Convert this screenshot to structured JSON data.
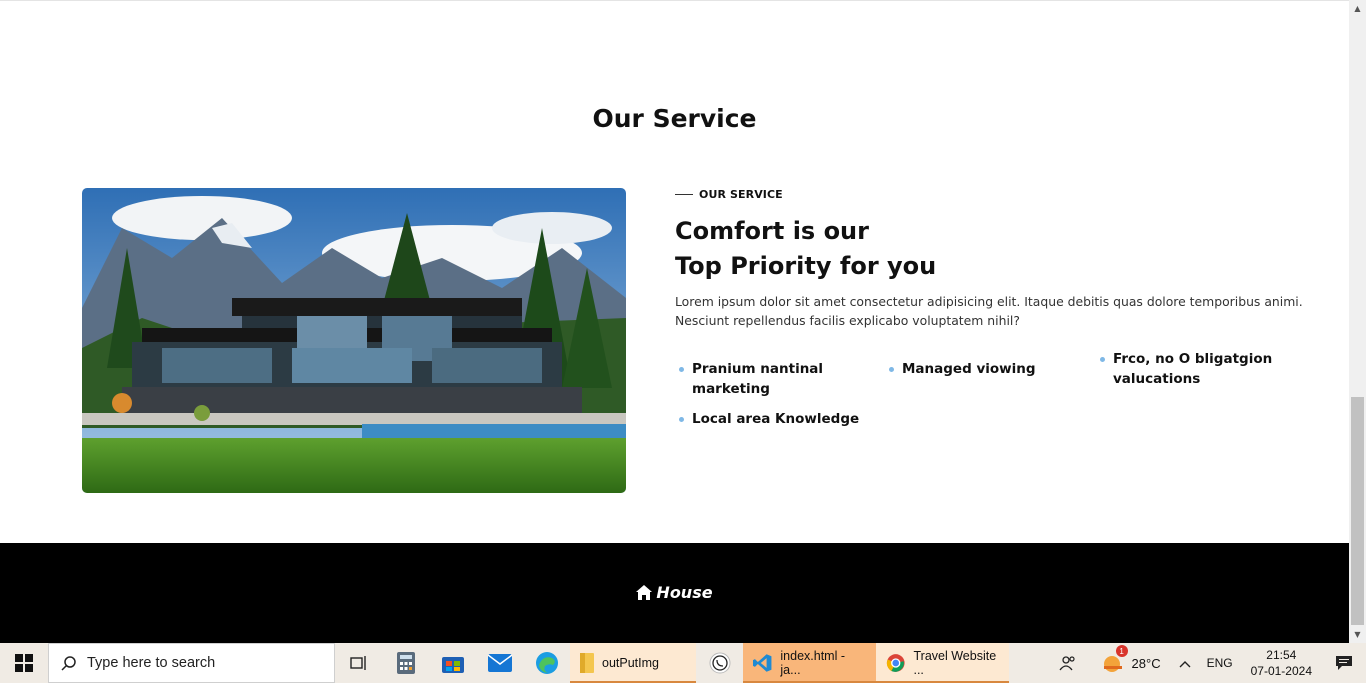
{
  "section": {
    "title": "Our Service"
  },
  "service": {
    "eyebrow": "OUR SERVICE",
    "heading_line1": "Comfort is our",
    "heading_line2": "Top Priority for you",
    "paragraph": "Lorem ipsum dolor sit amet consectetur adipisicing elit. Itaque debitis quas dolore temporibus animi. Nesciunt repellendus facilis explicabo voluptatem nihil?",
    "features": [
      "Pranium nantinal marketing",
      "Managed viowing",
      "Frco, no O bligatgion valucations",
      "Local area Knowledge"
    ],
    "accent_color": "#7fb8e6"
  },
  "footer": {
    "brand": "House",
    "icon": "home-icon"
  },
  "taskbar": {
    "search_placeholder": "Type here to search",
    "apps": [
      {
        "label": "outPutImg",
        "icon": "folder-icon"
      },
      {
        "label": "index.html - ja...",
        "icon": "vscode-icon"
      },
      {
        "label": "Travel Website ...",
        "icon": "chrome-icon"
      }
    ],
    "weather": "28°C",
    "weather_badge": "1",
    "language": "ENG",
    "time": "21:54",
    "date": "07-01-2024"
  }
}
